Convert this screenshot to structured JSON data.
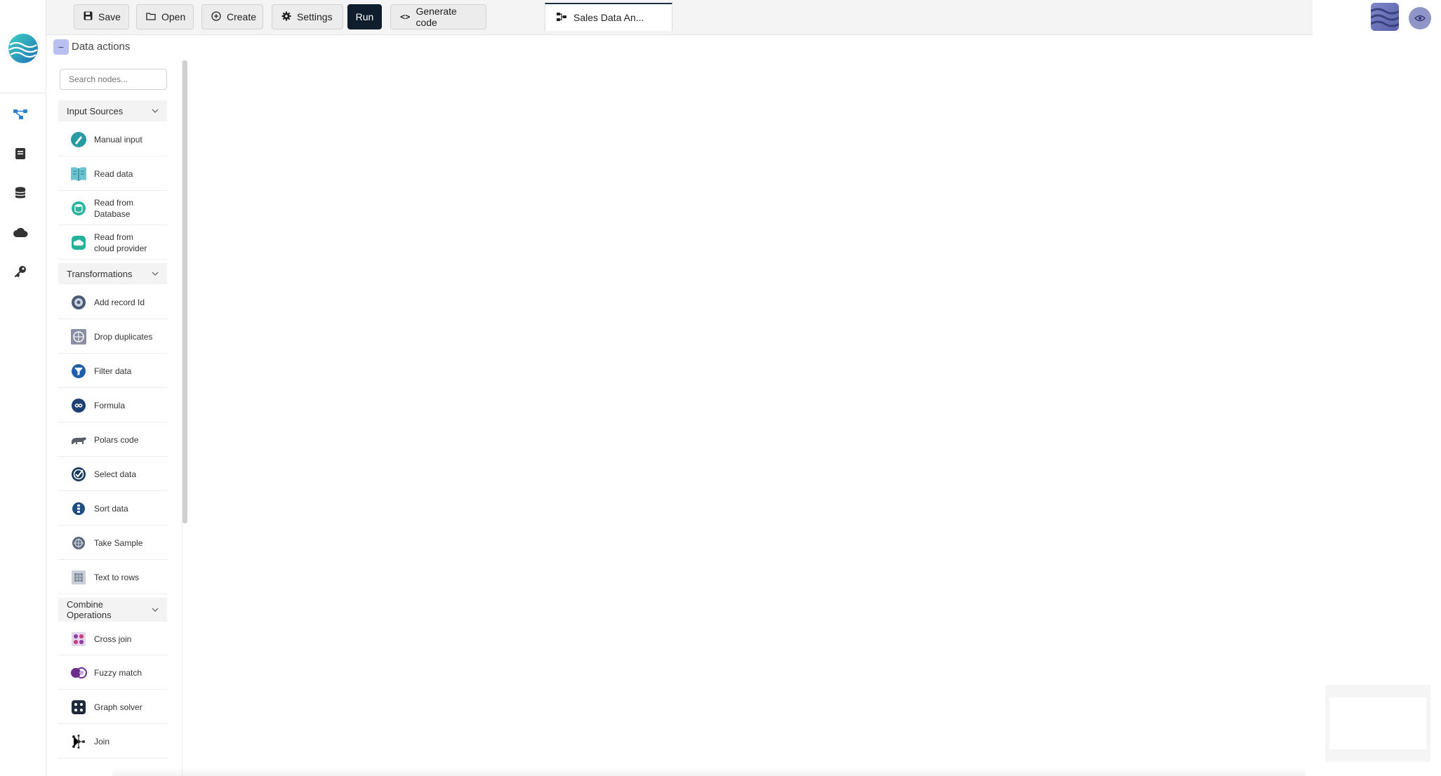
{
  "toolbar": {
    "save_label": "Save",
    "open_label": "Open",
    "create_label": "Create",
    "settings_label": "Settings",
    "run_label": "Run",
    "generate_label": "Generate code"
  },
  "tab": {
    "label": "Sales Data An..."
  },
  "rail": {
    "items": [
      "flow-icon",
      "book-icon",
      "database-icon",
      "cloud-icon",
      "key-icon"
    ],
    "accent": "#2a7fd0"
  },
  "data_actions": {
    "title": "Data actions",
    "toggle": "−",
    "search_placeholder": "Search nodes..."
  },
  "sections": {
    "input": {
      "label": "Input Sources",
      "items": [
        {
          "label": "Manual input",
          "icon": "manual-input-icon"
        },
        {
          "label": "Read data",
          "icon": "book-icon"
        },
        {
          "label": "Read from\nDatabase",
          "icon": "database-icon"
        },
        {
          "label": "Read from\ncloud provider",
          "icon": "cloud-icon"
        }
      ]
    },
    "transform": {
      "label": "Transformations",
      "items": [
        {
          "label": "Add record Id",
          "icon": "record-id-icon"
        },
        {
          "label": "Drop duplicates",
          "icon": "duplicates-icon"
        },
        {
          "label": "Filter data",
          "icon": "filter-icon"
        },
        {
          "label": "Formula",
          "icon": "formula-icon"
        },
        {
          "label": "Polars code",
          "icon": "polar-bear-icon"
        },
        {
          "label": "Select data",
          "icon": "check-icon"
        },
        {
          "label": "Sort data",
          "icon": "sort-icon"
        },
        {
          "label": "Take Sample",
          "icon": "sample-icon"
        },
        {
          "label": "Text to rows",
          "icon": "text-rows-icon"
        }
      ]
    },
    "combine": {
      "label": "Combine\nOperations",
      "items": [
        {
          "label": "Cross join",
          "icon": "cross-join-icon"
        },
        {
          "label": "Fuzzy match",
          "icon": "fuzzy-match-icon"
        },
        {
          "label": "Graph solver",
          "icon": "graph-icon"
        },
        {
          "label": "Join",
          "icon": "join-icon"
        }
      ]
    }
  }
}
